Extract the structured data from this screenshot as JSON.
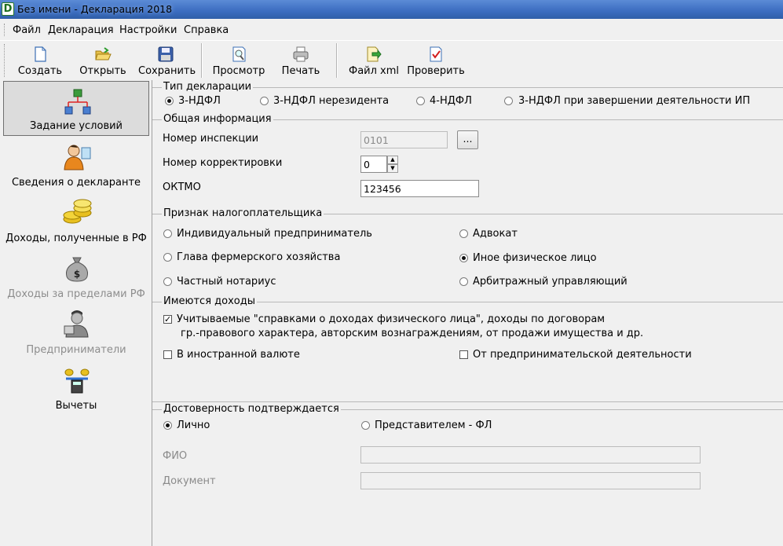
{
  "window": {
    "title": "Без имени - Декларация 2018"
  },
  "menu": [
    "Файл",
    "Декларация",
    "Настройки",
    "Справка"
  ],
  "toolbar": {
    "create": "Создать",
    "open": "Открыть",
    "save": "Сохранить",
    "preview": "Просмотр",
    "print": "Печать",
    "xml": "Файл xml",
    "check": "Проверить"
  },
  "nav": {
    "conditions": "Задание условий",
    "declarant": "Сведения о декларанте",
    "income_rf": "Доходы, полученные в РФ",
    "income_abroad": "Доходы за пределами РФ",
    "entrepreneurs": "Предприниматели",
    "deductions": "Вычеты"
  },
  "decl_type": {
    "title": "Тип декларации",
    "options": [
      "3-НДФЛ",
      "3-НДФЛ нерезидента",
      "4-НДФЛ",
      "3-НДФЛ при завершении деятельности ИП"
    ],
    "selected": "3-НДФЛ"
  },
  "general": {
    "title": "Общая информация",
    "inspection_label": "Номер инспекции",
    "inspection_value": "0101",
    "browse_label": "...",
    "correction_label": "Номер корректировки",
    "correction_value": "0",
    "oktmo_label": "ОКТМО",
    "oktmo_value": "123456"
  },
  "taxpayer": {
    "title": "Признак налогоплательщика",
    "options": [
      "Индивидуальный предприниматель",
      "Адвокат",
      "Глава фермерского хозяйства",
      "Иное физическое лицо",
      "Частный нотариус",
      "Арбитражный управляющий"
    ],
    "selected": "Иное физическое лицо"
  },
  "income": {
    "title": "Имеются доходы",
    "opt1_line1": "Учитываемые \"справками о доходах физического лица\", доходы по договорам",
    "opt1_line2": "гр.-правового характера, авторским вознаграждениям, от продажи имущества и др.",
    "opt1_checked": true,
    "opt2": "В иностранной валюте",
    "opt2_checked": false,
    "opt3": "От предпринимательской деятельности",
    "opt3_checked": false
  },
  "confirm": {
    "title": "Достоверность подтверждается",
    "personal": "Лично",
    "representative": "Представителем - ФЛ",
    "selected": "Лично",
    "fio_label": "ФИО",
    "doc_label": "Документ"
  }
}
